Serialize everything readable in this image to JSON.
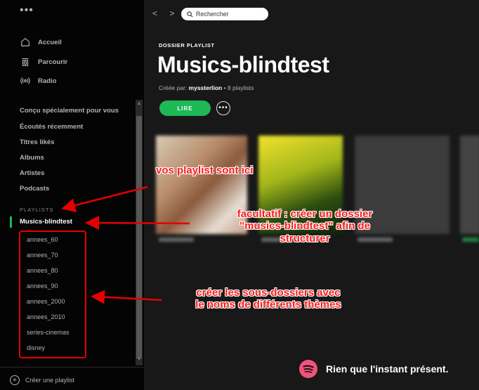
{
  "sidebar": {
    "menu": "•••",
    "nav": [
      {
        "label": "Accueil",
        "icon": "home-icon"
      },
      {
        "label": "Parcourir",
        "icon": "browse-icon"
      },
      {
        "label": "Radio",
        "icon": "radio-icon"
      }
    ],
    "library": [
      "Conçu spécialement pour vous",
      "Écoutés récemment",
      "Titres likés",
      "Albums",
      "Artistes",
      "Podcasts"
    ],
    "playlists_label": "PLAYLISTS",
    "active_folder": "Musics-blindtest",
    "subfolders": [
      "annees_60",
      "annees_70",
      "annees_80",
      "annees_90",
      "annees_2000",
      "annees_2010",
      "series-cinemas",
      "disney"
    ],
    "create_playlist": "Créer une playlist"
  },
  "topbar": {
    "back": "<",
    "forward": ">",
    "search_placeholder": "Rechercher"
  },
  "header": {
    "type_label": "DOSSIER PLAYLIST",
    "title": "Musics-blindtest",
    "created_by_prefix": "Créée par: ",
    "owner": "myssterlion",
    "count": " • 8 playlists",
    "play_label": "LIRE",
    "more_label": "•••"
  },
  "annotations": {
    "playlists_here": "vos playlist sont ici",
    "optional_line1": "facultatif : créer un dossier",
    "optional_line2": "\"musics-blindtest\" afin de",
    "optional_line3": "structurer",
    "subfolders_line1": "créer les sous-dossiers avec",
    "subfolders_line2": "le noms de différents thèmes",
    "color": "#ff1a1a"
  },
  "branding": {
    "tagline": "Rien que l'instant présent.",
    "logo_color": "#f0537a"
  },
  "colors": {
    "accent": "#1db954",
    "sidebar_bg": "#040404",
    "main_bg": "#181818"
  }
}
